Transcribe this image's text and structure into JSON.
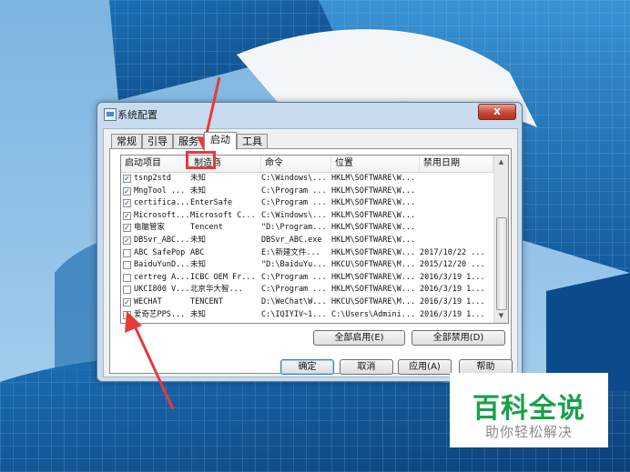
{
  "window": {
    "title": "系统配置",
    "close_label": "x"
  },
  "tabs": [
    {
      "label": "常规",
      "active": false
    },
    {
      "label": "引导",
      "active": false
    },
    {
      "label": "服务",
      "active": false
    },
    {
      "label": "启动",
      "active": true
    },
    {
      "label": "工具",
      "active": false
    }
  ],
  "list": {
    "columns": [
      "启动项目",
      "制造商",
      "命令",
      "位置",
      "禁用日期"
    ],
    "rows": [
      {
        "checked": true,
        "item": "tsnp2std",
        "maker": "未知",
        "command": "C:\\Windows\\...",
        "location": "HKLM\\SOFTWARE\\W...",
        "date": ""
      },
      {
        "checked": true,
        "item": "MngTool ...",
        "maker": "未知",
        "command": "C:\\Program ...",
        "location": "HKLM\\SOFTWARE\\W...",
        "date": ""
      },
      {
        "checked": true,
        "item": "certifica...",
        "maker": "EnterSafe",
        "command": "C:\\Program ...",
        "location": "HKLM\\SOFTWARE\\W...",
        "date": ""
      },
      {
        "checked": true,
        "item": "Microsoft...",
        "maker": "Microsoft C...",
        "command": "C:\\Windows\\...",
        "location": "HKLM\\SOFTWARE\\W...",
        "date": ""
      },
      {
        "checked": true,
        "item": "电脑管家",
        "maker": "Tencent",
        "command": "\"D:\\Program...",
        "location": "HKLM\\SOFTWARE\\W...",
        "date": ""
      },
      {
        "checked": true,
        "item": "DBSvr_ABC...",
        "maker": "未知",
        "command": "DBSvr_ABC.exe",
        "location": "HKLM\\SOFTWARE\\W...",
        "date": ""
      },
      {
        "checked": false,
        "item": "ABC SafePop",
        "maker": "ABC",
        "command": "E:\\新建文件...",
        "location": "HKLM\\SOFTWARE\\W...",
        "date": "2017/10/22 ..."
      },
      {
        "checked": false,
        "item": "BaiduYunD...",
        "maker": "未知",
        "command": "\"D:\\BaiduYu...",
        "location": "HKCU\\SOFTWARE\\M...",
        "date": "2015/12/20 ..."
      },
      {
        "checked": false,
        "item": "certreg A...",
        "maker": "ICBC OEM Fr...",
        "command": "C:\\Program ...",
        "location": "HKLM\\SOFTWARE\\W...",
        "date": "2016/3/19 1..."
      },
      {
        "checked": false,
        "item": "UKCI800 V...",
        "maker": "北京华大智...",
        "command": "C:\\Program ...",
        "location": "HKLM\\SOFTWARE\\W...",
        "date": "2016/3/19 1..."
      },
      {
        "checked": true,
        "item": "WECHAT",
        "maker": "TENCENT",
        "command": "D:\\WeChat\\W...",
        "location": "HKCU\\SOFTWARE\\M...",
        "date": "2016/3/19 1..."
      },
      {
        "checked": false,
        "item": "爱奇艺PPS...",
        "maker": "未知",
        "command": "C:\\IQIYIV~1...",
        "location": "C:\\Users\\Admini...",
        "date": "2016/3/19 1..."
      }
    ]
  },
  "buttons": {
    "enable_all": "全部启用(E)",
    "disable_all": "全部禁用(D)",
    "ok": "确定",
    "cancel": "取消",
    "apply": "应用(A)",
    "help": "帮助"
  },
  "watermark": {
    "title": "百科全说",
    "subtitle": "助你轻松解决"
  },
  "colors": {
    "annotation_red": "#e53b3b",
    "watermark_green": "#19a14a"
  }
}
